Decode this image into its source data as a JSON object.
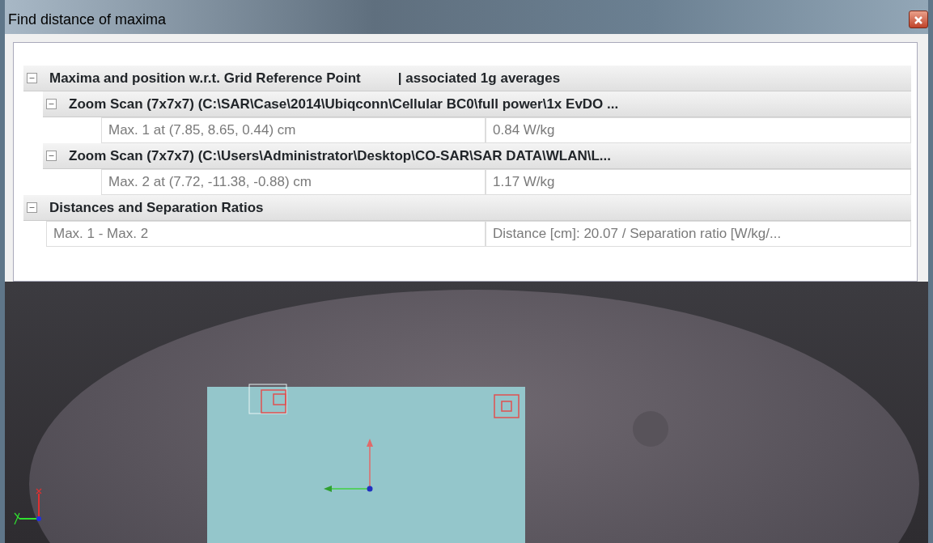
{
  "window": {
    "title": "Find distance of maxima"
  },
  "tree": [
    {
      "label": "Maxima and position w.r.t. Grid Reference Point",
      "label_2": "| associated 1g averages",
      "expanded": true,
      "children": [
        {
          "label": "Zoom Scan (7x7x7) (C:\\SAR\\Case\\2014\\Ubiqconn\\Cellular BC0\\full power\\1x EvDO ...",
          "expanded": true,
          "rows": [
            {
              "label": "Max. 1 at (7.85, 8.65, 0.44) cm",
              "value": "0.84 W/kg"
            }
          ]
        },
        {
          "label": "Zoom Scan (7x7x7) (C:\\Users\\Administrator\\Desktop\\CO-SAR\\SAR DATA\\WLAN\\L...",
          "expanded": true,
          "rows": [
            {
              "label": "Max. 2 at (7.72, -11.38, -0.88) cm",
              "value": "1.17 W/kg"
            }
          ]
        }
      ]
    },
    {
      "label": "Distances and Separation Ratios",
      "expanded": true,
      "rows": [
        {
          "label": "Max. 1 - Max. 2",
          "value": "Distance [cm]: 20.07 / Separation ratio [W/kg/..."
        }
      ]
    }
  ],
  "viewport": {
    "markers": [
      {
        "selected": true
      },
      {
        "selected": false
      }
    ]
  }
}
